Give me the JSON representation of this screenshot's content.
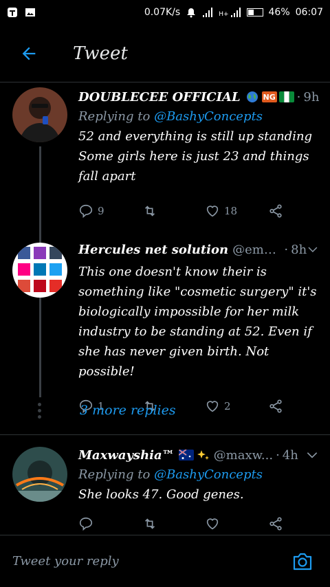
{
  "statusbar": {
    "speed": "0.07K/s",
    "network": "H+",
    "battery_pct": "46%",
    "battery_level": 0.46,
    "time": "06:07"
  },
  "appbar": {
    "title": "Tweet"
  },
  "tweets": [
    {
      "name": "DOUBLECEE OFFICIAL",
      "handle": "",
      "time": "9h",
      "reply_prefix": "Replying to",
      "reply_mention": "@BashyConcepts",
      "text": "52 and everything is still up standing Some girls here is just 23 and things fall apart",
      "replies": "9",
      "retweets": "",
      "likes": "18",
      "flag_badge": "NG"
    },
    {
      "name": "Hercules net solution",
      "handle": "@emm...",
      "time": "8h",
      "text": "This one doesn't know their is something like \"cosmetic surgery\" it's biologically impossible for her milk industry to be standing at 52. Even if she has never given birth. Not possible!",
      "replies": "1",
      "retweets": "",
      "likes": "2"
    },
    {
      "name": "Maxwayshia™",
      "handle": "@maxw...",
      "time": "4h",
      "reply_prefix": "Replying to",
      "reply_mention": "@BashyConcepts",
      "text": "She looks 47. Good genes."
    }
  ],
  "more_replies": "3 more replies",
  "composer": {
    "placeholder": "Tweet your reply"
  },
  "colors": {
    "accent": "#1d9bf0",
    "muted": "#8b98a5",
    "bg": "#000000"
  }
}
